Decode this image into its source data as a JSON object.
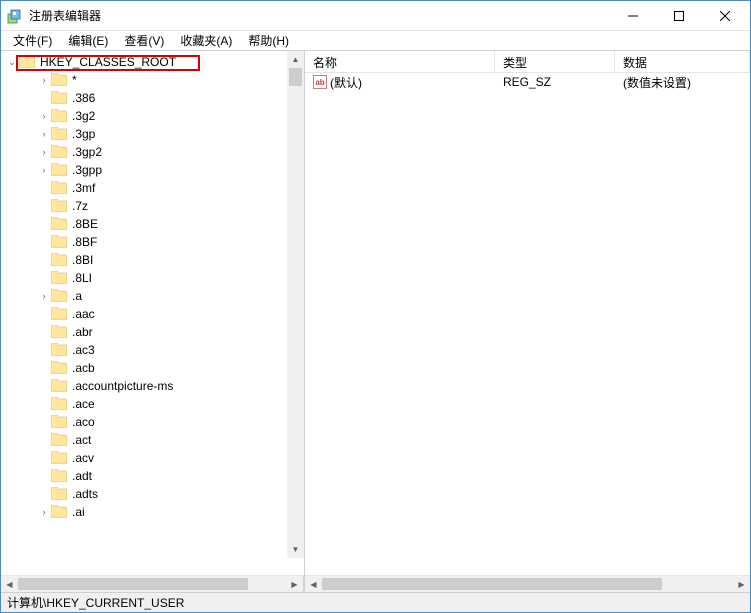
{
  "window": {
    "title": "注册表编辑器"
  },
  "menu": {
    "file": "文件(F)",
    "edit": "编辑(E)",
    "view": "查看(V)",
    "favorites": "收藏夹(A)",
    "help": "帮助(H)"
  },
  "tree": {
    "root": {
      "label": "HKEY_CLASSES_ROOT",
      "expanded": true
    },
    "items": [
      {
        "label": "*",
        "expandable": true
      },
      {
        "label": ".386",
        "expandable": false
      },
      {
        "label": ".3g2",
        "expandable": true
      },
      {
        "label": ".3gp",
        "expandable": true
      },
      {
        "label": ".3gp2",
        "expandable": true
      },
      {
        "label": ".3gpp",
        "expandable": true
      },
      {
        "label": ".3mf",
        "expandable": false
      },
      {
        "label": ".7z",
        "expandable": false
      },
      {
        "label": ".8BE",
        "expandable": false
      },
      {
        "label": ".8BF",
        "expandable": false
      },
      {
        "label": ".8BI",
        "expandable": false
      },
      {
        "label": ".8LI",
        "expandable": false
      },
      {
        "label": ".a",
        "expandable": true
      },
      {
        "label": ".aac",
        "expandable": false
      },
      {
        "label": ".abr",
        "expandable": false
      },
      {
        "label": ".ac3",
        "expandable": false
      },
      {
        "label": ".acb",
        "expandable": false
      },
      {
        "label": ".accountpicture-ms",
        "expandable": false
      },
      {
        "label": ".ace",
        "expandable": false
      },
      {
        "label": ".aco",
        "expandable": false
      },
      {
        "label": ".act",
        "expandable": false
      },
      {
        "label": ".acv",
        "expandable": false
      },
      {
        "label": ".adt",
        "expandable": false
      },
      {
        "label": ".adts",
        "expandable": false
      },
      {
        "label": ".ai",
        "expandable": true
      }
    ]
  },
  "list": {
    "columns": {
      "name": "名称",
      "type": "类型",
      "data": "数据"
    },
    "rows": [
      {
        "name": "(默认)",
        "type": "REG_SZ",
        "data": "(数值未设置)"
      }
    ]
  },
  "statusbar": {
    "path": "计算机\\HKEY_CURRENT_USER"
  },
  "colwidths": {
    "name": 190,
    "type": 120,
    "data": 150
  }
}
